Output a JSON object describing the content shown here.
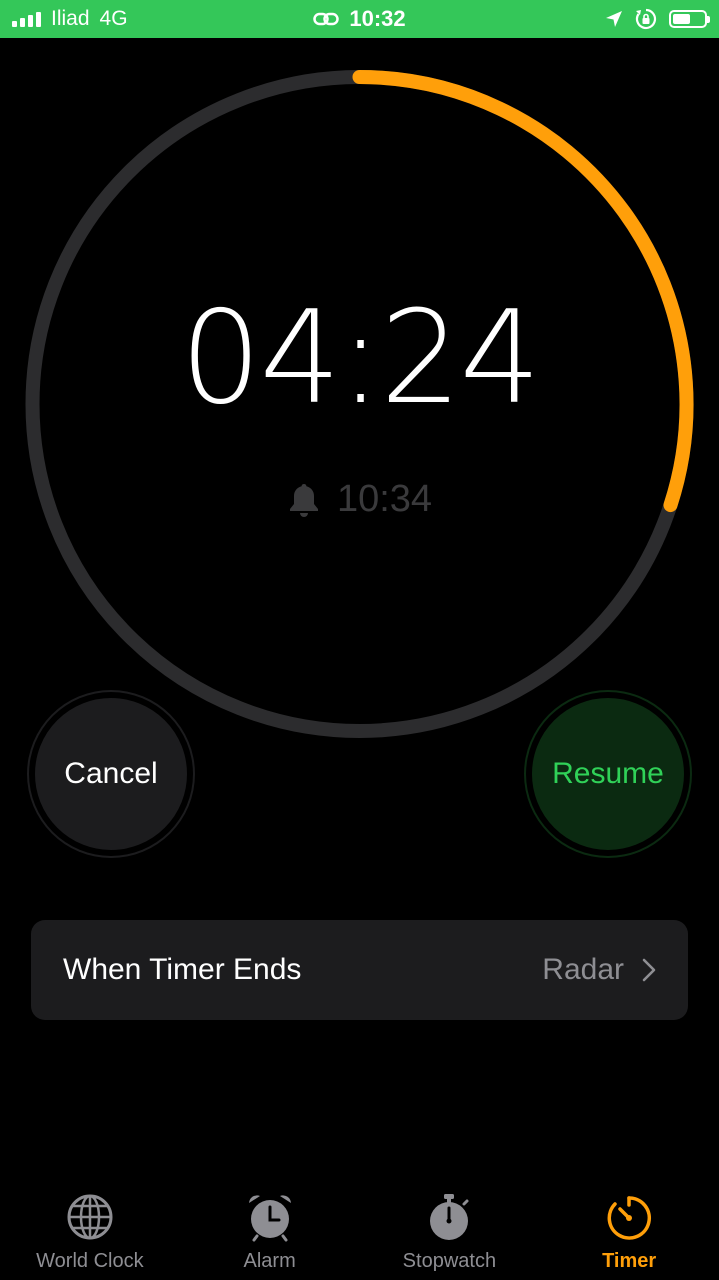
{
  "status_bar": {
    "carrier": "Iliad",
    "network": "4G",
    "time": "10:32",
    "battery_level": 0.55,
    "icons": [
      "signal-icon",
      "link-icon",
      "location-icon",
      "rotation-lock-icon",
      "battery-icon"
    ]
  },
  "timer": {
    "remaining": "04:24",
    "end_time": "10:34",
    "progress_remaining": 0.3,
    "colors": {
      "track": "#2c2c2e",
      "progress": "#FF9F0A"
    }
  },
  "buttons": {
    "cancel_label": "Cancel",
    "resume_label": "Resume"
  },
  "when_timer_ends": {
    "label": "When Timer Ends",
    "value": "Radar"
  },
  "tabs": [
    {
      "label": "World Clock",
      "icon": "globe-icon",
      "active": false
    },
    {
      "label": "Alarm",
      "icon": "alarm-clock-icon",
      "active": false
    },
    {
      "label": "Stopwatch",
      "icon": "stopwatch-icon",
      "active": false
    },
    {
      "label": "Timer",
      "icon": "timer-icon",
      "active": true
    }
  ],
  "accent_colors": {
    "status_bar": "#34C759",
    "resume": "#30D158",
    "active_tab": "#FF9F0A"
  }
}
